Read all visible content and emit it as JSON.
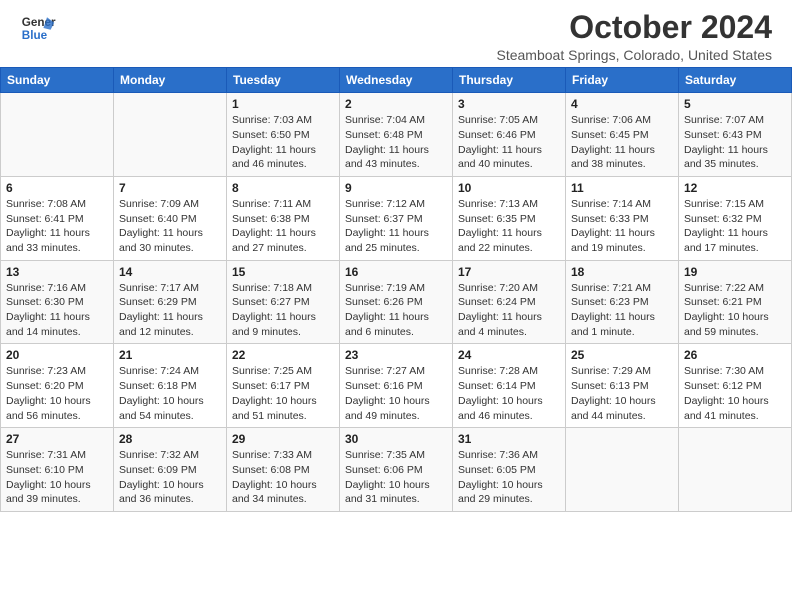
{
  "header": {
    "logo_line1": "General",
    "logo_line2": "Blue",
    "month": "October 2024",
    "location": "Steamboat Springs, Colorado, United States"
  },
  "weekdays": [
    "Sunday",
    "Monday",
    "Tuesday",
    "Wednesday",
    "Thursday",
    "Friday",
    "Saturday"
  ],
  "weeks": [
    [
      {
        "day": "",
        "info": ""
      },
      {
        "day": "",
        "info": ""
      },
      {
        "day": "1",
        "info": "Sunrise: 7:03 AM\nSunset: 6:50 PM\nDaylight: 11 hours and 46 minutes."
      },
      {
        "day": "2",
        "info": "Sunrise: 7:04 AM\nSunset: 6:48 PM\nDaylight: 11 hours and 43 minutes."
      },
      {
        "day": "3",
        "info": "Sunrise: 7:05 AM\nSunset: 6:46 PM\nDaylight: 11 hours and 40 minutes."
      },
      {
        "day": "4",
        "info": "Sunrise: 7:06 AM\nSunset: 6:45 PM\nDaylight: 11 hours and 38 minutes."
      },
      {
        "day": "5",
        "info": "Sunrise: 7:07 AM\nSunset: 6:43 PM\nDaylight: 11 hours and 35 minutes."
      }
    ],
    [
      {
        "day": "6",
        "info": "Sunrise: 7:08 AM\nSunset: 6:41 PM\nDaylight: 11 hours and 33 minutes."
      },
      {
        "day": "7",
        "info": "Sunrise: 7:09 AM\nSunset: 6:40 PM\nDaylight: 11 hours and 30 minutes."
      },
      {
        "day": "8",
        "info": "Sunrise: 7:11 AM\nSunset: 6:38 PM\nDaylight: 11 hours and 27 minutes."
      },
      {
        "day": "9",
        "info": "Sunrise: 7:12 AM\nSunset: 6:37 PM\nDaylight: 11 hours and 25 minutes."
      },
      {
        "day": "10",
        "info": "Sunrise: 7:13 AM\nSunset: 6:35 PM\nDaylight: 11 hours and 22 minutes."
      },
      {
        "day": "11",
        "info": "Sunrise: 7:14 AM\nSunset: 6:33 PM\nDaylight: 11 hours and 19 minutes."
      },
      {
        "day": "12",
        "info": "Sunrise: 7:15 AM\nSunset: 6:32 PM\nDaylight: 11 hours and 17 minutes."
      }
    ],
    [
      {
        "day": "13",
        "info": "Sunrise: 7:16 AM\nSunset: 6:30 PM\nDaylight: 11 hours and 14 minutes."
      },
      {
        "day": "14",
        "info": "Sunrise: 7:17 AM\nSunset: 6:29 PM\nDaylight: 11 hours and 12 minutes."
      },
      {
        "day": "15",
        "info": "Sunrise: 7:18 AM\nSunset: 6:27 PM\nDaylight: 11 hours and 9 minutes."
      },
      {
        "day": "16",
        "info": "Sunrise: 7:19 AM\nSunset: 6:26 PM\nDaylight: 11 hours and 6 minutes."
      },
      {
        "day": "17",
        "info": "Sunrise: 7:20 AM\nSunset: 6:24 PM\nDaylight: 11 hours and 4 minutes."
      },
      {
        "day": "18",
        "info": "Sunrise: 7:21 AM\nSunset: 6:23 PM\nDaylight: 11 hours and 1 minute."
      },
      {
        "day": "19",
        "info": "Sunrise: 7:22 AM\nSunset: 6:21 PM\nDaylight: 10 hours and 59 minutes."
      }
    ],
    [
      {
        "day": "20",
        "info": "Sunrise: 7:23 AM\nSunset: 6:20 PM\nDaylight: 10 hours and 56 minutes."
      },
      {
        "day": "21",
        "info": "Sunrise: 7:24 AM\nSunset: 6:18 PM\nDaylight: 10 hours and 54 minutes."
      },
      {
        "day": "22",
        "info": "Sunrise: 7:25 AM\nSunset: 6:17 PM\nDaylight: 10 hours and 51 minutes."
      },
      {
        "day": "23",
        "info": "Sunrise: 7:27 AM\nSunset: 6:16 PM\nDaylight: 10 hours and 49 minutes."
      },
      {
        "day": "24",
        "info": "Sunrise: 7:28 AM\nSunset: 6:14 PM\nDaylight: 10 hours and 46 minutes."
      },
      {
        "day": "25",
        "info": "Sunrise: 7:29 AM\nSunset: 6:13 PM\nDaylight: 10 hours and 44 minutes."
      },
      {
        "day": "26",
        "info": "Sunrise: 7:30 AM\nSunset: 6:12 PM\nDaylight: 10 hours and 41 minutes."
      }
    ],
    [
      {
        "day": "27",
        "info": "Sunrise: 7:31 AM\nSunset: 6:10 PM\nDaylight: 10 hours and 39 minutes."
      },
      {
        "day": "28",
        "info": "Sunrise: 7:32 AM\nSunset: 6:09 PM\nDaylight: 10 hours and 36 minutes."
      },
      {
        "day": "29",
        "info": "Sunrise: 7:33 AM\nSunset: 6:08 PM\nDaylight: 10 hours and 34 minutes."
      },
      {
        "day": "30",
        "info": "Sunrise: 7:35 AM\nSunset: 6:06 PM\nDaylight: 10 hours and 31 minutes."
      },
      {
        "day": "31",
        "info": "Sunrise: 7:36 AM\nSunset: 6:05 PM\nDaylight: 10 hours and 29 minutes."
      },
      {
        "day": "",
        "info": ""
      },
      {
        "day": "",
        "info": ""
      }
    ]
  ]
}
